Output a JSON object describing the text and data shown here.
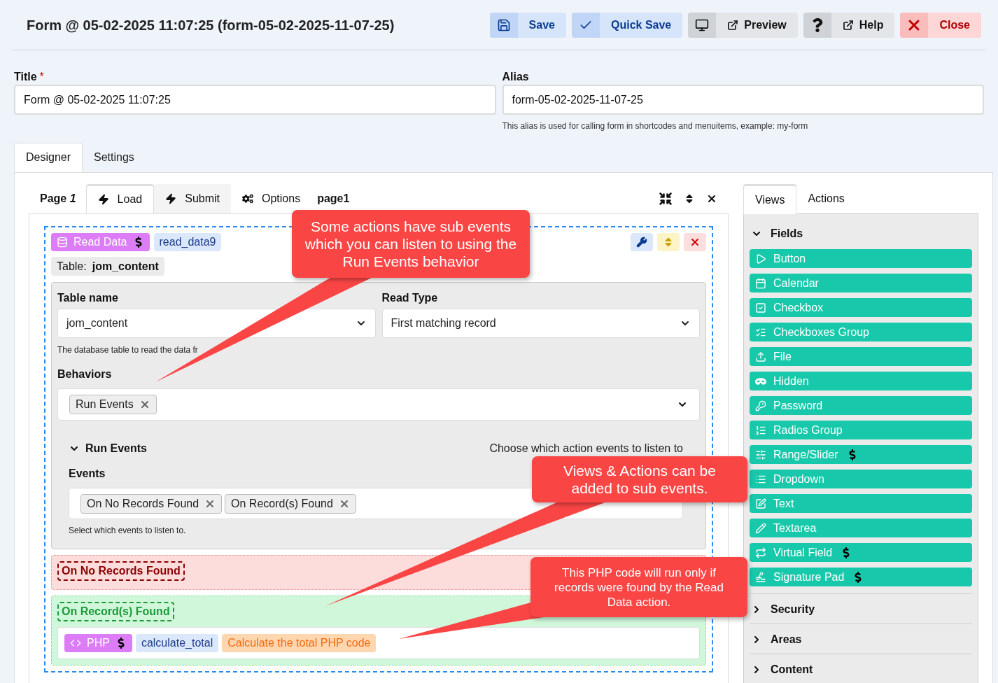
{
  "header": {
    "title": "Form @ 05-02-2025 11:07:25 (form-05-02-2025-11-07-25)",
    "buttons": [
      {
        "kind": "save",
        "label": "Save"
      },
      {
        "kind": "quick_save",
        "label": "Quick Save"
      },
      {
        "kind": "preview",
        "label": "Preview"
      },
      {
        "kind": "help",
        "label": "Help"
      },
      {
        "kind": "close",
        "label": "Close"
      }
    ]
  },
  "title_field": {
    "label": "Title",
    "required_mark": "*",
    "value": "Form @ 05-02-2025 11:07:25"
  },
  "alias_field": {
    "label": "Alias",
    "value": "form-05-02-2025-11-07-25",
    "help": "This alias is used for calling form in shortcodes and menuitems, example: my-form"
  },
  "main_tabs": [
    {
      "label": "Designer",
      "selected": true
    },
    {
      "label": "Settings",
      "selected": false
    }
  ],
  "designer": {
    "page_label": "Page",
    "page_number": "1",
    "event_tabs": [
      {
        "label": "Load",
        "selected": true
      },
      {
        "label": "Submit",
        "selected": false
      }
    ],
    "options_label": "Options",
    "page_name": "page1",
    "action": {
      "type_label": "Read Data",
      "paid": true,
      "name": "read_data9",
      "table_prefix": "Table:",
      "table": "jom_content",
      "selects": [
        {
          "label": "Table name",
          "value": "jom_content"
        },
        {
          "label": "Read Type",
          "value": "First matching record"
        }
      ],
      "table_help": "The database table to read the data fr",
      "behaviors": {
        "label": "Behaviors",
        "tags": [
          "Run Events"
        ]
      },
      "run_events": {
        "title": "Run Events",
        "expanded": true,
        "hint": "Choose which action events to listen to",
        "events_label": "Events",
        "tags": [
          "On No Records Found",
          "On Record(s) Found"
        ],
        "help": "Select which events to listen to."
      },
      "events": [
        {
          "kind": "no_records",
          "title": "On No Records Found"
        },
        {
          "kind": "found",
          "title": "On Record(s) Found",
          "actions": [
            {
              "type_label": "PHP",
              "paid": true,
              "name": "calculate_total",
              "description": "Calculate the total PHP code"
            }
          ]
        }
      ]
    }
  },
  "palette": {
    "tabs": [
      {
        "label": "Views",
        "selected": true
      },
      {
        "label": "Actions",
        "selected": false
      }
    ],
    "groups": [
      {
        "title": "Fields",
        "expanded": true,
        "items": [
          {
            "label": "Button",
            "paid": false
          },
          {
            "label": "Calendar",
            "paid": false
          },
          {
            "label": "Checkbox",
            "paid": false
          },
          {
            "label": "Checkboxes Group",
            "paid": false
          },
          {
            "label": "File",
            "paid": false
          },
          {
            "label": "Hidden",
            "paid": false
          },
          {
            "label": "Password",
            "paid": false
          },
          {
            "label": "Radios Group",
            "paid": false
          },
          {
            "label": "Range/Slider",
            "paid": true
          },
          {
            "label": "Dropdown",
            "paid": false
          },
          {
            "label": "Text",
            "paid": false
          },
          {
            "label": "Textarea",
            "paid": false
          },
          {
            "label": "Virtual Field",
            "paid": true
          },
          {
            "label": "Signature Pad",
            "paid": true
          }
        ]
      },
      {
        "title": "Security",
        "expanded": false
      },
      {
        "title": "Areas",
        "expanded": false
      },
      {
        "title": "Content",
        "expanded": false
      }
    ]
  },
  "callouts": [
    {
      "text": "Some actions have sub events which you can listen to using the Run Events behavior"
    },
    {
      "text": "Views & Actions can be added to sub events."
    },
    {
      "text": "This PHP code will run only if records were found by the Read Data action."
    }
  ]
}
